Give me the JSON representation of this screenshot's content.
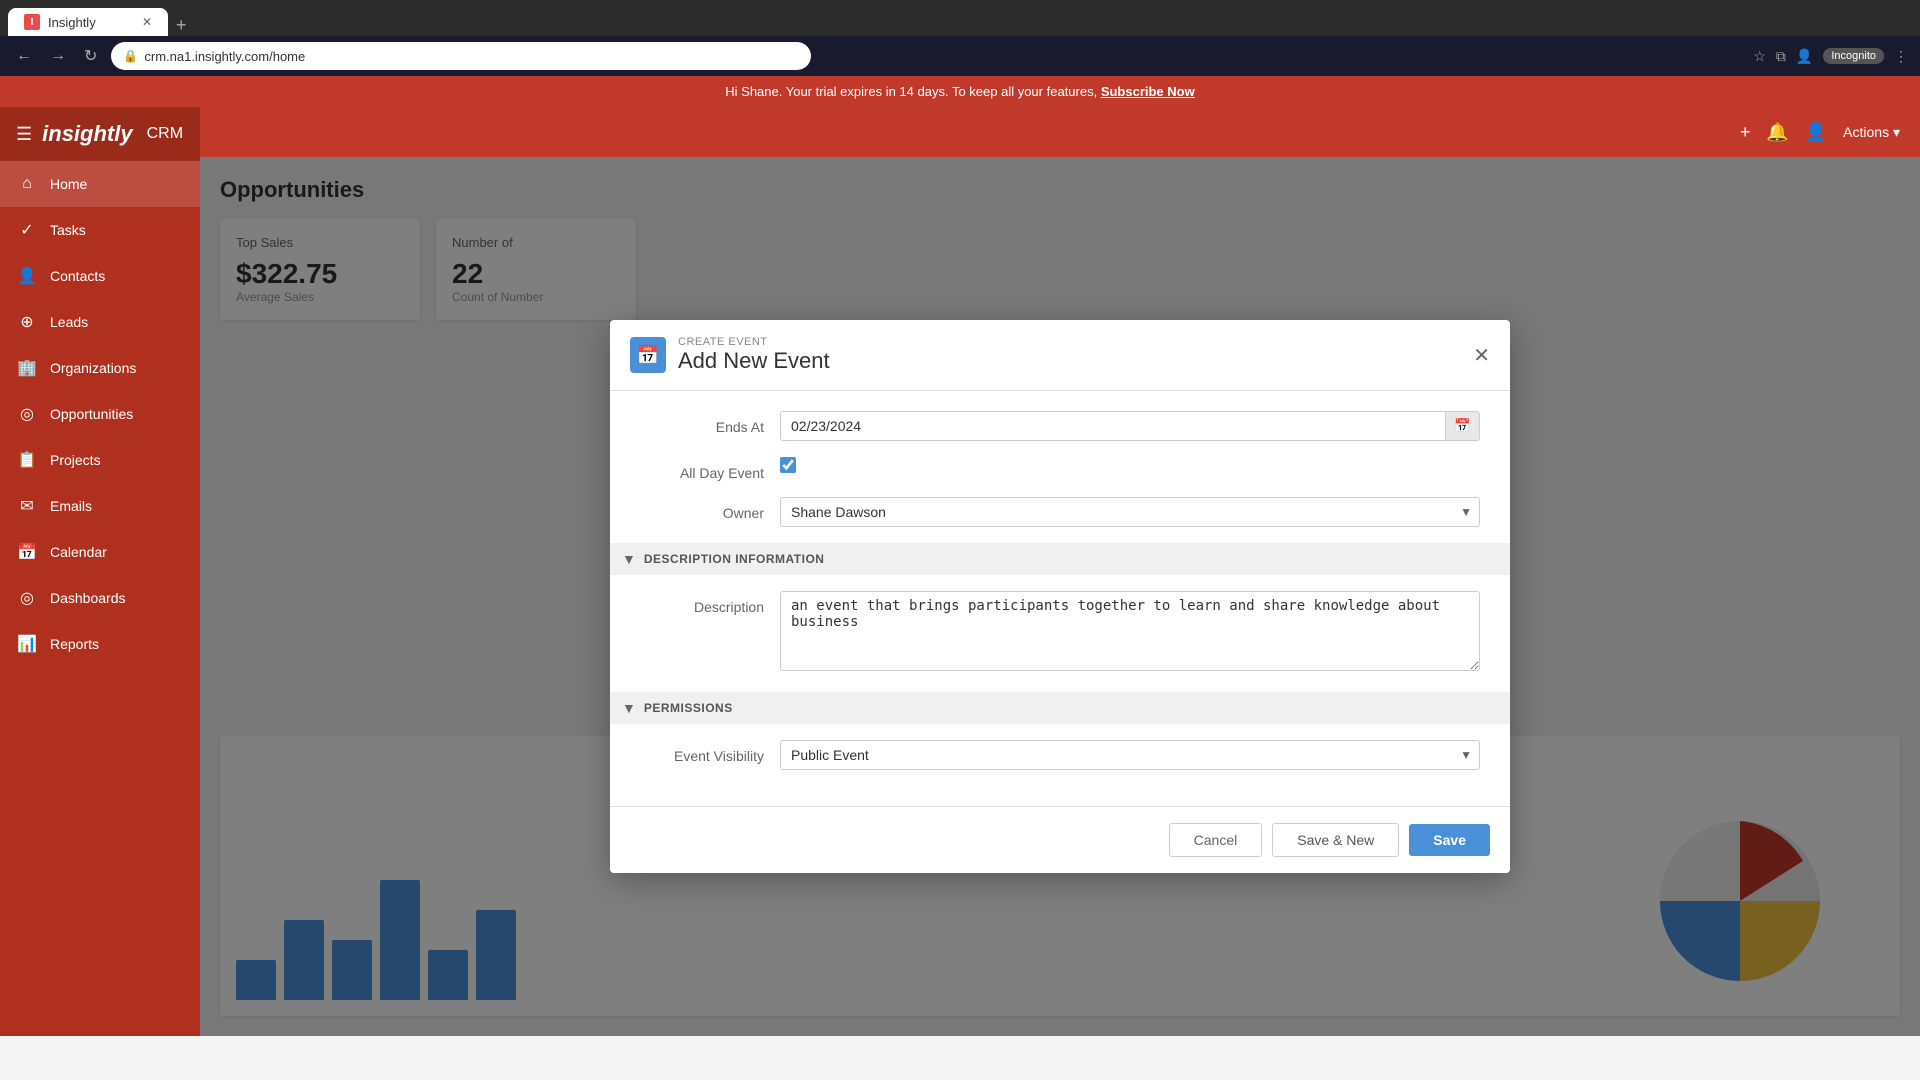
{
  "browser": {
    "tab_label": "Insightly",
    "favicon": "I",
    "url": "crm.na1.insightly.com/home",
    "incognito_label": "Incognito",
    "new_tab_symbol": "+",
    "back_symbol": "←",
    "forward_symbol": "→",
    "refresh_symbol": "↻"
  },
  "notification": {
    "message": "Hi Shane. Your trial expires in 14 days. To keep all your features,",
    "link_text": "Subscribe Now"
  },
  "sidebar": {
    "logo": "insightly",
    "crm": "CRM",
    "items": [
      {
        "id": "home",
        "label": "Home",
        "icon": "⌂"
      },
      {
        "id": "tasks",
        "label": "Tasks",
        "icon": "✓"
      },
      {
        "id": "contacts",
        "label": "Contacts",
        "icon": "👤"
      },
      {
        "id": "leads",
        "label": "Leads",
        "icon": "⊕"
      },
      {
        "id": "organizations",
        "label": "Organizations",
        "icon": "🏢"
      },
      {
        "id": "opportunities",
        "label": "Opportunities",
        "icon": "◎"
      },
      {
        "id": "projects",
        "label": "Projects",
        "icon": "📋"
      },
      {
        "id": "emails",
        "label": "Emails",
        "icon": "✉"
      },
      {
        "id": "calendar",
        "label": "Calendar",
        "icon": "📅"
      },
      {
        "id": "dashboards",
        "label": "Dashboards",
        "icon": "◎"
      },
      {
        "id": "reports",
        "label": "Reports",
        "icon": "📊"
      }
    ]
  },
  "main": {
    "title": "Opportunities",
    "actions_label": "Actions ▾"
  },
  "dashboard": {
    "top_sales_label": "Top Sales",
    "top_sales_value": "$322.75",
    "top_sales_sub": "Average Sales",
    "number_label": "Number of",
    "number_value": "22",
    "number_sub": "Count of Number"
  },
  "modal": {
    "create_event_label": "CREATE EVENT",
    "title": "Add New Event",
    "close_symbol": "✕",
    "fields": {
      "ends_at_label": "Ends At",
      "ends_at_value": "02/23/2024",
      "all_day_label": "All Day Event",
      "all_day_checked": true,
      "owner_label": "Owner",
      "owner_value": "Shane Dawson",
      "description_label": "Description",
      "description_value": "an event that brings participants together to learn and share knowledge about business",
      "event_visibility_label": "Event Visibility",
      "event_visibility_value": "Public Event"
    },
    "sections": {
      "description_title": "DESCRIPTION INFORMATION",
      "permissions_title": "PERMISSIONS"
    },
    "footer": {
      "cancel_label": "Cancel",
      "save_new_label": "Save & New",
      "save_label": "Save"
    }
  }
}
